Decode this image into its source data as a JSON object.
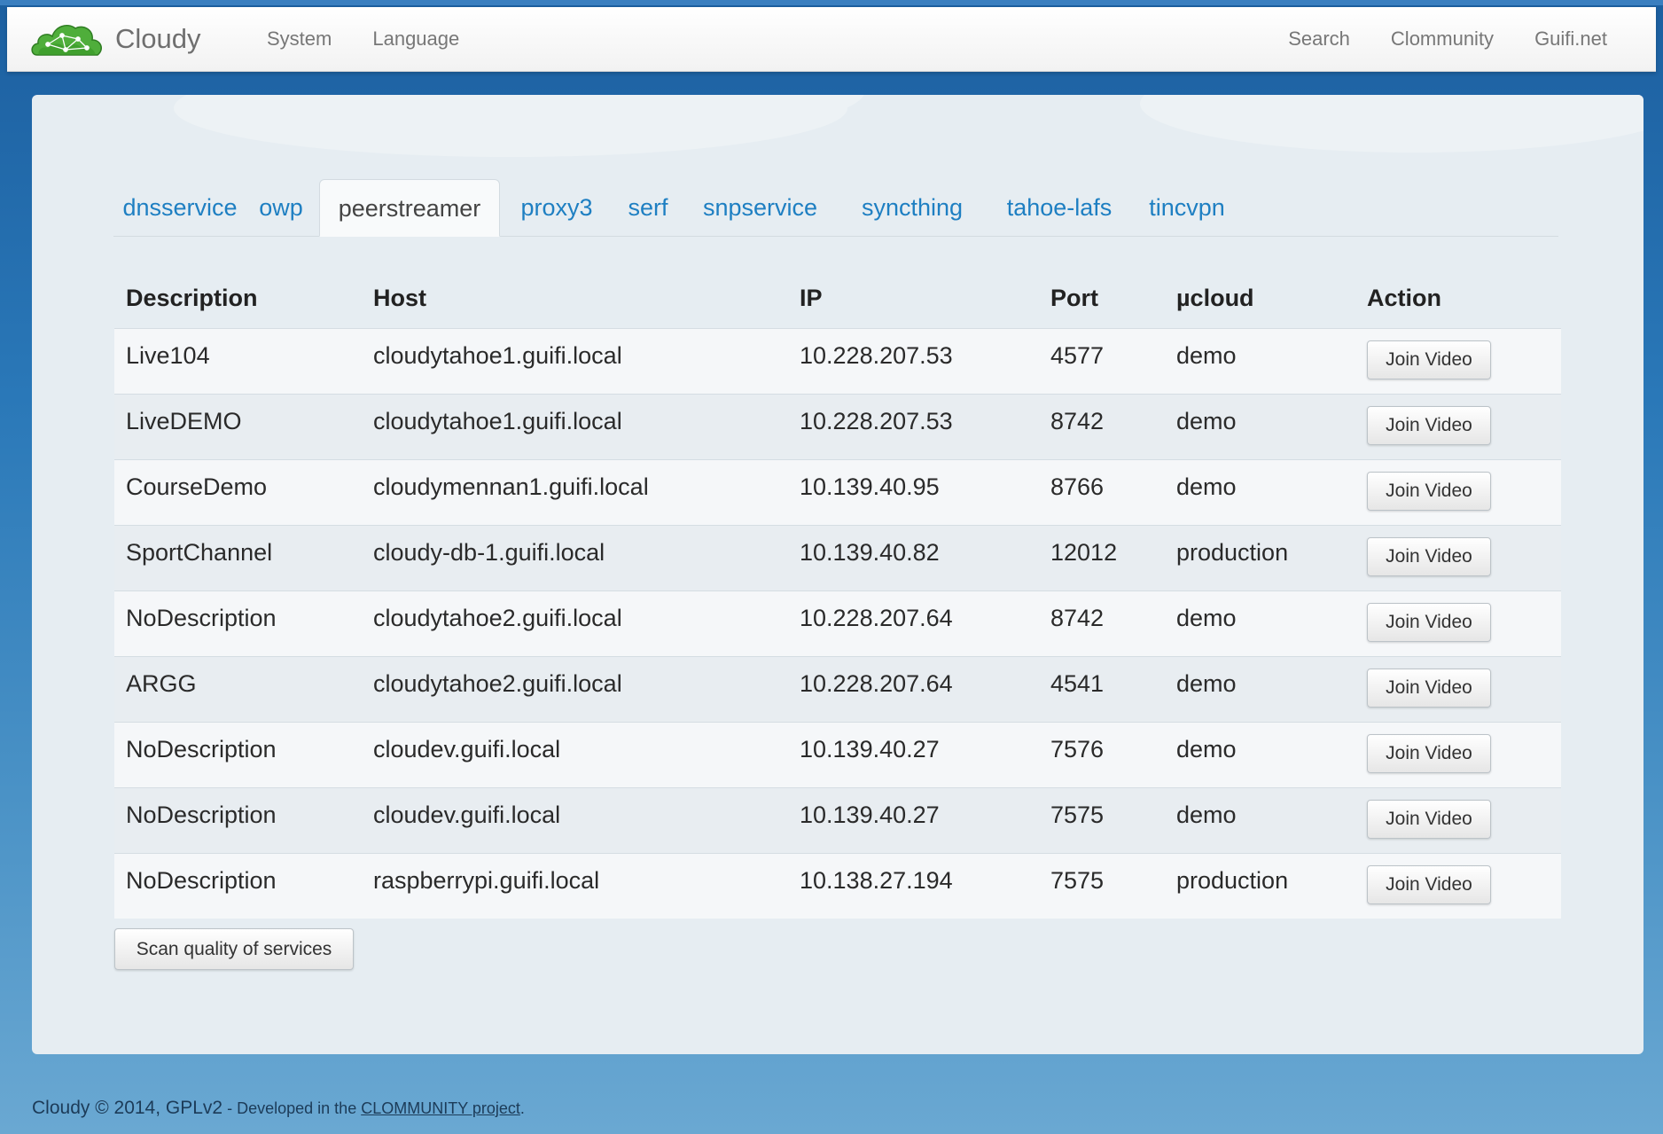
{
  "navbar": {
    "brand": "Cloudy",
    "left_links": [
      "System",
      "Language"
    ],
    "right_links": [
      "Search",
      "Clommunity",
      "Guifi.net"
    ]
  },
  "tabs": [
    "dnsservice",
    "owp",
    "peerstreamer",
    "proxy3",
    "serf",
    "snpservice",
    "syncthing",
    "tahoe-lafs",
    "tincvpn"
  ],
  "active_tab": "peerstreamer",
  "table": {
    "headers": [
      "Description",
      "Host",
      "IP",
      "Port",
      "µcloud",
      "Action"
    ],
    "rows": [
      {
        "description": "Live104",
        "host": "cloudytahoe1.guifi.local",
        "ip": "10.228.207.53",
        "port": "4577",
        "ucloud": "demo",
        "action": "Join Video"
      },
      {
        "description": "LiveDEMO",
        "host": "cloudytahoe1.guifi.local",
        "ip": "10.228.207.53",
        "port": "8742",
        "ucloud": "demo",
        "action": "Join Video"
      },
      {
        "description": "CourseDemo",
        "host": "cloudymennan1.guifi.local",
        "ip": "10.139.40.95",
        "port": "8766",
        "ucloud": "demo",
        "action": "Join Video"
      },
      {
        "description": "SportChannel",
        "host": "cloudy-db-1.guifi.local",
        "ip": "10.139.40.82",
        "port": "12012",
        "ucloud": "production",
        "action": "Join Video"
      },
      {
        "description": "NoDescription",
        "host": "cloudytahoe2.guifi.local",
        "ip": "10.228.207.64",
        "port": "8742",
        "ucloud": "demo",
        "action": "Join Video"
      },
      {
        "description": "ARGG",
        "host": "cloudytahoe2.guifi.local",
        "ip": "10.228.207.64",
        "port": "4541",
        "ucloud": "demo",
        "action": "Join Video"
      },
      {
        "description": "NoDescription",
        "host": "cloudev.guifi.local",
        "ip": "10.139.40.27",
        "port": "7576",
        "ucloud": "demo",
        "action": "Join Video"
      },
      {
        "description": "NoDescription",
        "host": "cloudev.guifi.local",
        "ip": "10.139.40.27",
        "port": "7575",
        "ucloud": "demo",
        "action": "Join Video"
      },
      {
        "description": "NoDescription",
        "host": "raspberrypi.guifi.local",
        "ip": "10.138.27.194",
        "port": "7575",
        "ucloud": "production",
        "action": "Join Video"
      }
    ]
  },
  "scan_button": "Scan quality of services",
  "footer": {
    "text": "Cloudy © 2014, GPLv2",
    "dev_text": " - Developed in the ",
    "link_text": "CLOMMUNITY project",
    "end": "."
  },
  "icons": {
    "brand_logo": "cloud-network-logo-icon"
  },
  "colors": {
    "link": "#1e7fc2",
    "brand_green": "#4caf3a",
    "background_blue": "#2a78b8"
  }
}
